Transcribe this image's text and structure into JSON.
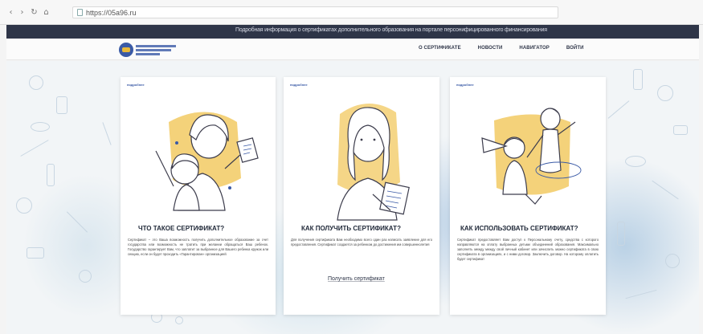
{
  "browser": {
    "back": "‹",
    "forward": "›",
    "reload": "↻",
    "home": "⌂",
    "url": "https://05а96.ru"
  },
  "banner": {
    "text": "Подробная информация о сертификатах дополнительного образования на портале персонифицированного финансирования"
  },
  "header": {
    "nav": [
      {
        "label": "О СЕРТИФИКАТЕ"
      },
      {
        "label": "НОВОСТИ"
      },
      {
        "label": "НАВИГАТОР"
      },
      {
        "label": "ВОЙТИ"
      }
    ]
  },
  "cards": [
    {
      "kicker": "подробнее",
      "title": "ЧТО ТАКОЕ СЕРТИФИКАТ?",
      "text": "Сертификат – это Ваша возможность получить дополнительное образование за счет государства или возможность не тратить при желании обращаться Ваш ребенок. Государство гарантирует Вам, что заплатит за выбранное для Вашего ребенка кружок или секцию, если он будет проходить «Гарантирован» организацией"
    },
    {
      "kicker": "подробнее",
      "title": "КАК ПОЛУЧИТЬ СЕРТИФИКАТ?",
      "text": "Для получения сертификата Вам необходимо всего один раз написать заявление для его предоставления. Сертификат создается за ребенком до достижения им совершеннолетия",
      "link": "Получить сертификат"
    },
    {
      "kicker": "подробнее",
      "title": "КАК ИСПОЛЬЗОВАТЬ СЕРТИФИКАТ?",
      "text": "Сертификат предоставляет Вам доступ к Персональному счету, средства с которого направляются на оплату выбранных детьми объединений образования. Максимально заполнять между между свой личный кабинет или зачислить можно сертификата в свою сертификата в организациях, и с ними договор. Заключить договор. На которому оплатить будет сертификат"
    }
  ],
  "colors": {
    "dark": "#2e3548",
    "accent": "#3a5aa6",
    "yellow": "#f4d27a",
    "watercolor": "#9fc1df"
  }
}
